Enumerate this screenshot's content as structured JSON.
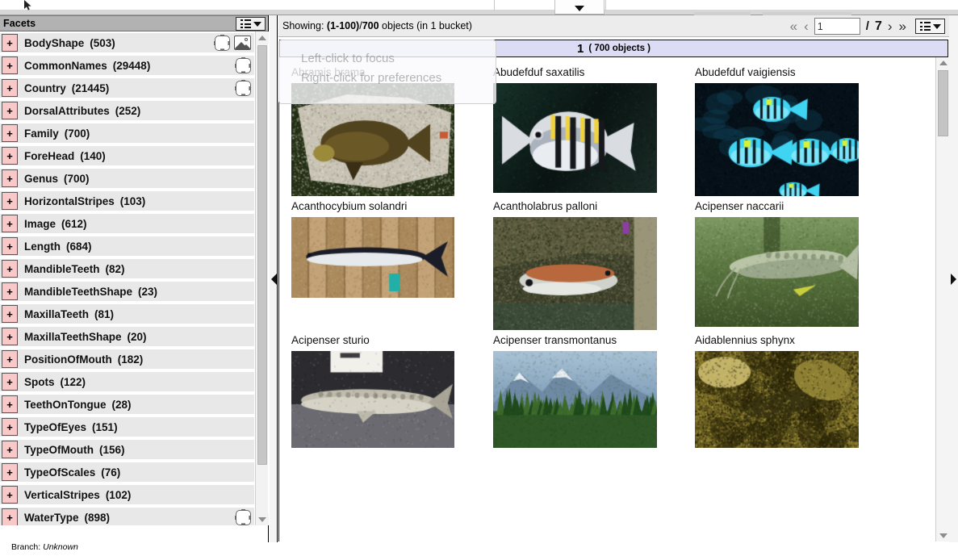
{
  "window": {
    "top_dropdown_icon": "chevron-down-icon",
    "cursor_icon": "mouse-cursor"
  },
  "sidebar": {
    "title": "Facets",
    "menu_icon": "list-menu-icon",
    "menu_caret_icon": "chevron-down-icon",
    "expand_symbol": "+",
    "items": [
      {
        "label": "BodyShape",
        "count": "(503)",
        "icons": [
          "crop-icon",
          "picture-icon"
        ]
      },
      {
        "label": "CommonNames",
        "count": "(29448)",
        "icons": [
          "crop-icon"
        ]
      },
      {
        "label": "Country",
        "count": "(21445)",
        "icons": [
          "crop-icon"
        ]
      },
      {
        "label": "DorsalAttributes",
        "count": "(252)",
        "icons": []
      },
      {
        "label": "Family",
        "count": "(700)",
        "icons": []
      },
      {
        "label": "ForeHead",
        "count": "(140)",
        "icons": []
      },
      {
        "label": "Genus",
        "count": "(700)",
        "icons": []
      },
      {
        "label": "HorizontalStripes",
        "count": "(103)",
        "icons": []
      },
      {
        "label": "Image",
        "count": "(612)",
        "icons": []
      },
      {
        "label": "Length",
        "count": "(684)",
        "icons": []
      },
      {
        "label": "MandibleTeeth",
        "count": "(82)",
        "icons": []
      },
      {
        "label": "MandibleTeethShape",
        "count": "(23)",
        "icons": []
      },
      {
        "label": "MaxillaTeeth",
        "count": "(81)",
        "icons": []
      },
      {
        "label": "MaxillaTeethShape",
        "count": "(20)",
        "icons": []
      },
      {
        "label": "PositionOfMouth",
        "count": "(182)",
        "icons": []
      },
      {
        "label": "Spots",
        "count": "(122)",
        "icons": []
      },
      {
        "label": "TeethOnTongue",
        "count": "(28)",
        "icons": []
      },
      {
        "label": "TypeOfEyes",
        "count": "(151)",
        "icons": []
      },
      {
        "label": "TypeOfMouth",
        "count": "(156)",
        "icons": []
      },
      {
        "label": "TypeOfScales",
        "count": "(76)",
        "icons": []
      },
      {
        "label": "VerticalStripes",
        "count": "(102)",
        "icons": []
      },
      {
        "label": "WaterType",
        "count": "(898)",
        "icons": [
          "crop-icon"
        ]
      }
    ]
  },
  "status": {
    "branch_label": "Branch:",
    "branch_value": "Unknown"
  },
  "toolbar": {
    "showing_label": "Showing:",
    "range": "(1-100)",
    "separator": "/",
    "total": "700",
    "objects_word": "objects",
    "buckets": "(in 1 bucket)",
    "first_icon": "«",
    "prev_icon": "‹",
    "page_value": "1",
    "page_sep": "/",
    "page_total": "7",
    "next_icon": "›",
    "last_icon": "»",
    "view_menu_icon": "list-menu-icon",
    "view_menu_caret_icon": "chevron-down-icon"
  },
  "bucket": {
    "number": "1",
    "count": "( 700 objects )"
  },
  "tooltip": {
    "line1": "Left-click to focus",
    "line2": "Right-click for preferences"
  },
  "splitter": {
    "collapse_left_icon": "arrow-left-icon",
    "collapse_right_icon": "arrow-right-icon"
  },
  "grid": {
    "rows": [
      [
        {
          "label": "Abramis brama",
          "thumb": "fish-brown-on-rock"
        },
        {
          "label": "Abudefduf saxatilis",
          "thumb": "fish-yellow-black-stripes"
        },
        {
          "label": "Abudefduf vaigiensis",
          "thumb": "fish-school-blue-stripes"
        }
      ],
      [
        {
          "label": "Acanthocybium solandri",
          "thumb": "fish-silver-on-planks"
        },
        {
          "label": "Acantholabrus palloni",
          "thumb": "fish-orange-in-crevice"
        },
        {
          "label": "Acipenser naccarii",
          "thumb": "sturgeon-green-water"
        }
      ],
      [
        {
          "label": "Acipenser sturio",
          "thumb": "sturgeon-specimen-dark-bg"
        },
        {
          "label": "Acipenser transmontanus",
          "thumb": "landscape-mountain-trees"
        },
        {
          "label": "Aidablennius sphynx",
          "thumb": "blenny-on-rock-olive"
        }
      ]
    ]
  },
  "colors": {
    "header_bg": "#b2b2b2",
    "facet_row_bg": "#e8e8e8",
    "plus_bg": "#f9c8c8",
    "bucket_bg": "#dcdcf5",
    "toolbar_bg": "#ececec"
  }
}
